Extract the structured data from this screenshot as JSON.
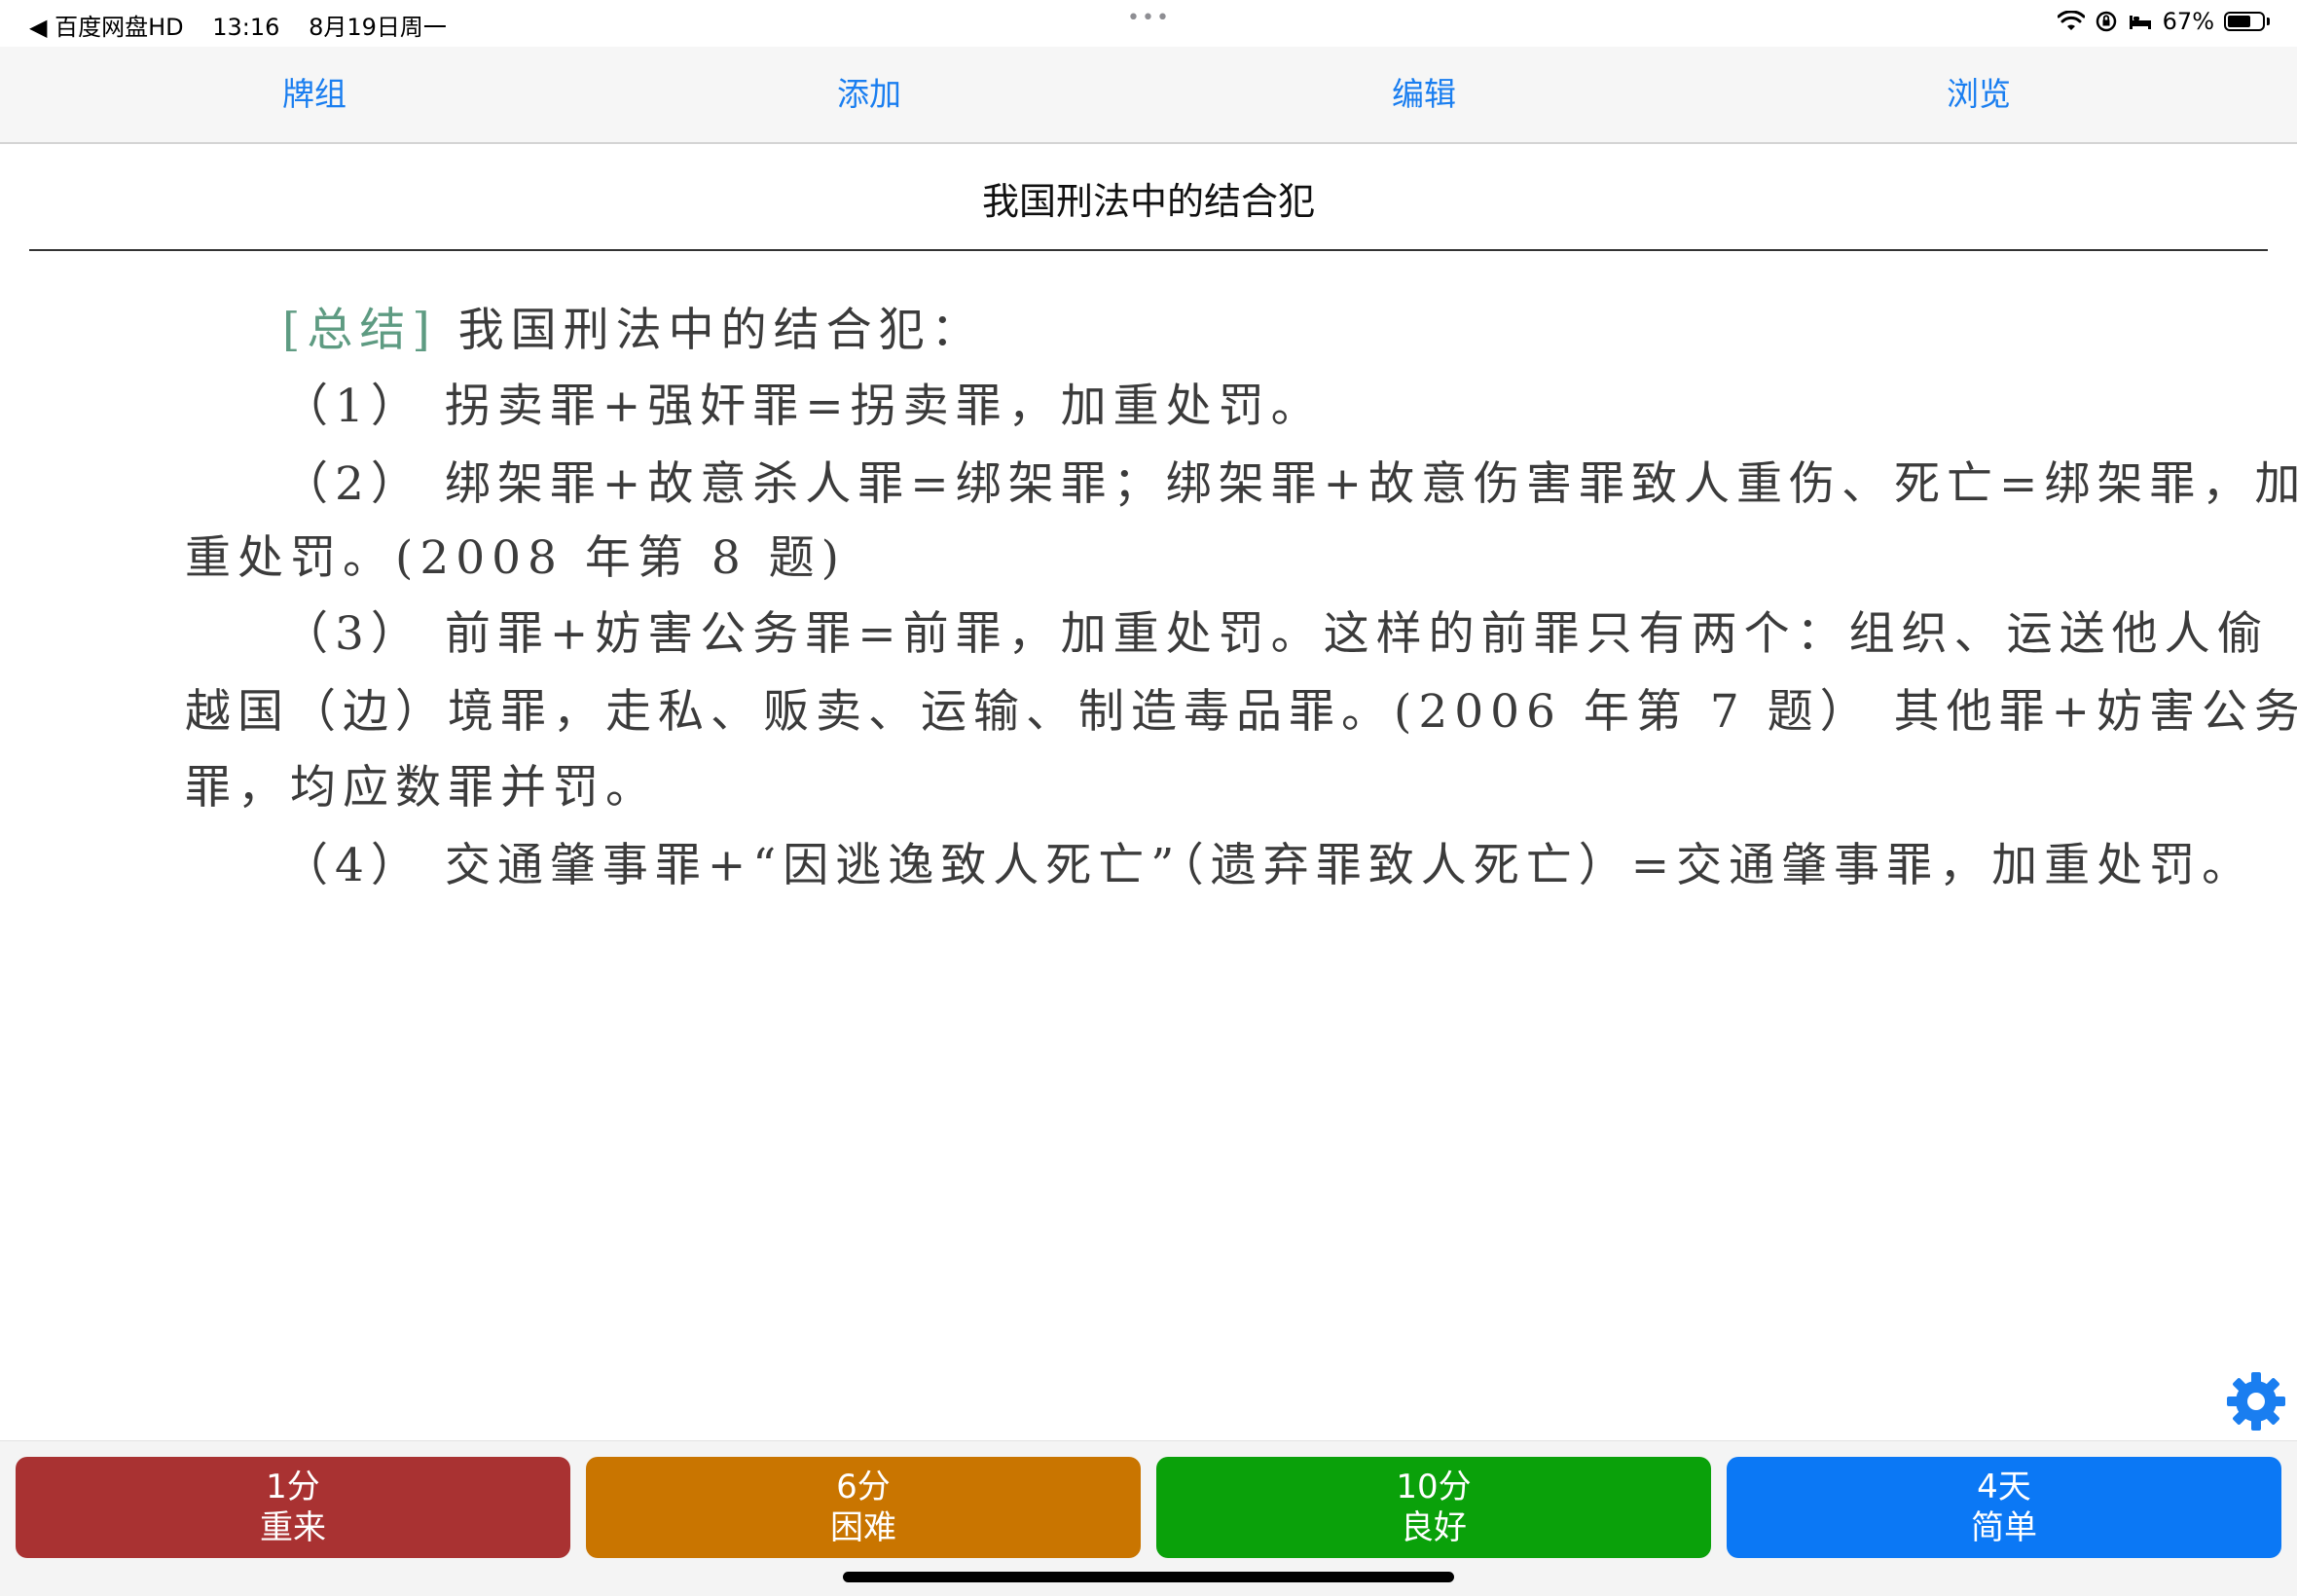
{
  "status": {
    "back_app": "◀ 百度网盘HD",
    "time": "13:16",
    "date": "8月19日周一",
    "battery_percent": "67%",
    "battery_level": 0.67,
    "dots": "•••"
  },
  "nav": {
    "tabs": [
      {
        "label": "牌组"
      },
      {
        "label": "添加"
      },
      {
        "label": "编辑"
      },
      {
        "label": "浏览"
      }
    ]
  },
  "card": {
    "title": "我国刑法中的结合犯",
    "summary_tag": "[总结]",
    "lines": [
      " 我国刑法中的结合犯：",
      "（1） 拐卖罪+强奸罪=拐卖罪，加重处罚。",
      "（2） 绑架罪+故意杀人罪=绑架罪；绑架罪+故意伤害罪致人重伤、死亡=绑架罪，加",
      "重处罚。(2008 年第 8 题)",
      "（3） 前罪+妨害公务罪=前罪，加重处罚。这样的前罪只有两个：组织、运送他人偷",
      "越国（边）境罪，走私、贩卖、运输、制造毒品罪。(2006 年第 7 题） 其他罪+妨害公务",
      "罪，均应数罪并罚。",
      "（4） 交通肇事罪+“因逃逸致人死亡”（遗弃罪致人死亡）=交通肇事罪，加重处罚。"
    ]
  },
  "answers": [
    {
      "interval": "1分",
      "label": "重来",
      "color": "#a93232"
    },
    {
      "interval": "6分",
      "label": "困难",
      "color": "#c97500"
    },
    {
      "interval": "10分",
      "label": "良好",
      "color": "#0aa10a"
    },
    {
      "interval": "4天",
      "label": "简单",
      "color": "#0b78f5"
    }
  ],
  "icons": {
    "settings": "gear-icon",
    "wifi": "wifi-icon",
    "lock_rotation": "orientation-lock-icon",
    "bed": "sleep-focus-icon",
    "battery": "battery-icon"
  }
}
